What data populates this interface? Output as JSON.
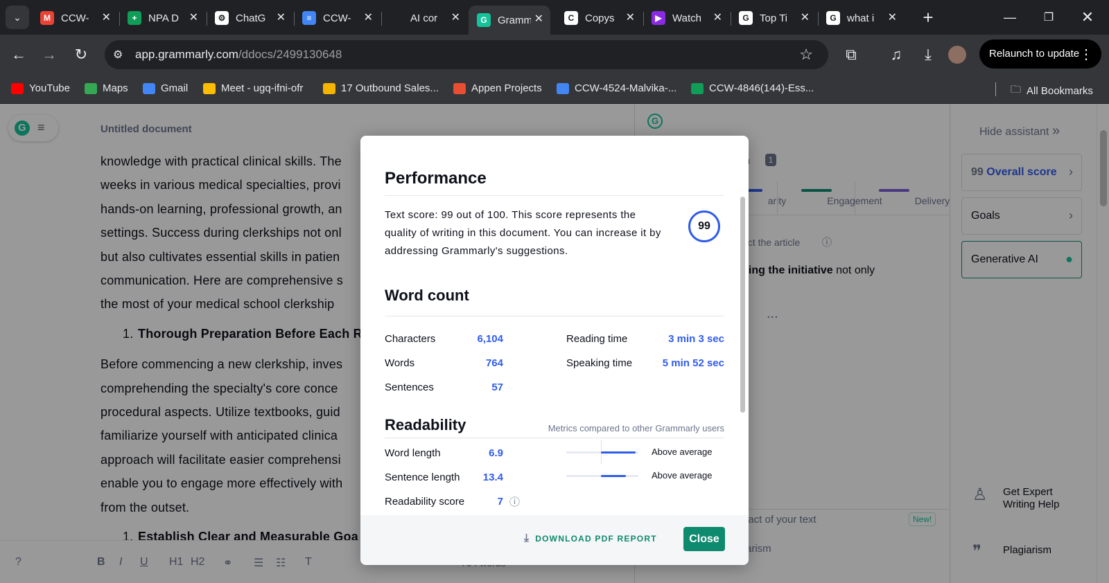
{
  "browser": {
    "tabs": [
      {
        "title": "CCW-",
        "icon": "gmail-icon",
        "color": "#ea4335",
        "glyph": "M"
      },
      {
        "title": "NPA D",
        "icon": "sheets-icon",
        "color": "#0f9d58",
        "glyph": "+"
      },
      {
        "title": "ChatG",
        "icon": "chatgpt-icon",
        "color": "#ffffff",
        "glyph": "⚙"
      },
      {
        "title": "CCW-",
        "icon": "docs-icon",
        "color": "#4285f4",
        "glyph": "≡"
      },
      {
        "title": "AI cor",
        "icon": "blank-icon",
        "color": "#202124",
        "glyph": ""
      },
      {
        "title": "Gramm",
        "icon": "grammarly-icon",
        "color": "#15c39a",
        "glyph": "G"
      },
      {
        "title": "Copys",
        "icon": "copyscape-icon",
        "color": "#ffffff",
        "glyph": "C"
      },
      {
        "title": "Watch",
        "icon": "play-icon",
        "color": "#8a2be2",
        "glyph": "▶"
      },
      {
        "title": "Top Ti",
        "icon": "google-icon",
        "color": "#ffffff",
        "glyph": "G"
      },
      {
        "title": "what i",
        "icon": "google-icon",
        "color": "#ffffff",
        "glyph": "G"
      }
    ],
    "url_host": "app.grammarly.com",
    "url_path": "/ddocs/2499130648",
    "relaunch_label": "Relaunch to update",
    "bookmarks": [
      {
        "label": "YouTube",
        "color": "#ff0000"
      },
      {
        "label": "Maps",
        "color": "#34a853"
      },
      {
        "label": "Gmail",
        "color": "#4285f4"
      },
      {
        "label": "Meet - ugq-ifni-ofr",
        "color": "#fbbc04"
      },
      {
        "label": "17 Outbound Sales...",
        "color": "#f4b400"
      },
      {
        "label": "Appen Projects",
        "color": "#e94e32"
      },
      {
        "label": "CCW-4524-Malvika-...",
        "color": "#4285f4"
      },
      {
        "label": "CCW-4846(144)-Ess...",
        "color": "#0f9d58"
      }
    ],
    "all_bookmarks": "All Bookmarks"
  },
  "editor": {
    "title": "Untitled document",
    "paragraph1": "knowledge with practical clinical skills. The weeks in various medical specialties, provi hands-on learning, professional growth, an settings. Success during clerkships not onl but also cultivates essential skills in patien communication. Here are comprehensive s the most of your medical school clerkship",
    "lines1": [
      "knowledge with practical clinical skills. The",
      "weeks in various medical specialties, provi",
      "hands-on learning, professional growth, an",
      "settings. Success during clerkships not onl",
      "but also cultivates essential skills in patien",
      "communication. Here are comprehensive s",
      "the most of your medical school clerkship"
    ],
    "heading1_num": "1.",
    "heading1": "Thorough Preparation Before Each R",
    "lines2": [
      "Before commencing a new clerkship, inves",
      "comprehending the specialty's core conce",
      "procedural aspects. Utilize textbooks, guid",
      "familiarize yourself with anticipated clinica",
      "approach will facilitate easier comprehensi",
      "enable you to engage more effectively with",
      "from the outset."
    ],
    "heading2_num": "1.",
    "heading2": "Establish Clear and Measurable Goa",
    "word_count": "764 words"
  },
  "assistant": {
    "title_fragment": "on",
    "badge": "1",
    "tabs": [
      {
        "label": "arity",
        "color": "#2f5bea"
      },
      {
        "label": "Engagement",
        "color": "#0e8a6e"
      },
      {
        "label": "Delivery",
        "color": "#7c5cd6"
      }
    ],
    "hint": "ect the article",
    "suggestion_bold": "king the initiative",
    "suggestion_rest": " not only",
    "more": "...",
    "impact": "pact of your text",
    "new_badge": "New!",
    "plag_fragment": "arism"
  },
  "sidebar": {
    "hide": "Hide assistant",
    "overall_score": "99",
    "overall_label": "Overall score",
    "goals": "Goals",
    "generative_ai": "Generative AI",
    "expert": "Get Expert Writing Help",
    "plagiarism": "Plagiarism"
  },
  "modal": {
    "perf_heading": "Performance",
    "perf_text": "Text score: 99 out of 100. This score represents the quality of writing in this document. You can increase it by addressing Grammarly's suggestions.",
    "score": "99",
    "wc_heading": "Word count",
    "characters_label": "Characters",
    "characters": "6,104",
    "words_label": "Words",
    "words": "764",
    "sentences_label": "Sentences",
    "sentences": "57",
    "reading_label": "Reading time",
    "reading": "3 min 3 sec",
    "speaking_label": "Speaking time",
    "speaking": "5 min 52 sec",
    "read_heading": "Readability",
    "compare_note": "Metrics compared to other Grammarly users",
    "word_length_label": "Word length",
    "word_length": "6.9",
    "word_length_level": "Above average",
    "word_length_fill": 0.5,
    "sentence_length_label": "Sentence length",
    "sentence_length": "13.4",
    "sentence_length_level": "Above average",
    "sentence_length_fill": 0.36,
    "readability_label": "Readability score",
    "readability": "7",
    "download": "DOWNLOAD PDF REPORT",
    "close": "Close"
  }
}
